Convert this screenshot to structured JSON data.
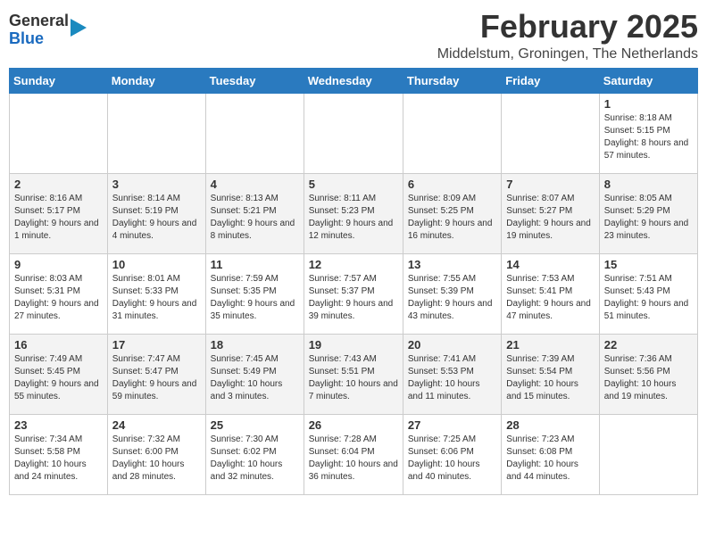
{
  "logo": {
    "general": "General",
    "blue": "Blue"
  },
  "title": "February 2025",
  "location": "Middelstum, Groningen, The Netherlands",
  "weekdays": [
    "Sunday",
    "Monday",
    "Tuesday",
    "Wednesday",
    "Thursday",
    "Friday",
    "Saturday"
  ],
  "weeks": [
    [
      {
        "day": "",
        "info": ""
      },
      {
        "day": "",
        "info": ""
      },
      {
        "day": "",
        "info": ""
      },
      {
        "day": "",
        "info": ""
      },
      {
        "day": "",
        "info": ""
      },
      {
        "day": "",
        "info": ""
      },
      {
        "day": "1",
        "info": "Sunrise: 8:18 AM\nSunset: 5:15 PM\nDaylight: 8 hours and 57 minutes."
      }
    ],
    [
      {
        "day": "2",
        "info": "Sunrise: 8:16 AM\nSunset: 5:17 PM\nDaylight: 9 hours and 1 minute."
      },
      {
        "day": "3",
        "info": "Sunrise: 8:14 AM\nSunset: 5:19 PM\nDaylight: 9 hours and 4 minutes."
      },
      {
        "day": "4",
        "info": "Sunrise: 8:13 AM\nSunset: 5:21 PM\nDaylight: 9 hours and 8 minutes."
      },
      {
        "day": "5",
        "info": "Sunrise: 8:11 AM\nSunset: 5:23 PM\nDaylight: 9 hours and 12 minutes."
      },
      {
        "day": "6",
        "info": "Sunrise: 8:09 AM\nSunset: 5:25 PM\nDaylight: 9 hours and 16 minutes."
      },
      {
        "day": "7",
        "info": "Sunrise: 8:07 AM\nSunset: 5:27 PM\nDaylight: 9 hours and 19 minutes."
      },
      {
        "day": "8",
        "info": "Sunrise: 8:05 AM\nSunset: 5:29 PM\nDaylight: 9 hours and 23 minutes."
      }
    ],
    [
      {
        "day": "9",
        "info": "Sunrise: 8:03 AM\nSunset: 5:31 PM\nDaylight: 9 hours and 27 minutes."
      },
      {
        "day": "10",
        "info": "Sunrise: 8:01 AM\nSunset: 5:33 PM\nDaylight: 9 hours and 31 minutes."
      },
      {
        "day": "11",
        "info": "Sunrise: 7:59 AM\nSunset: 5:35 PM\nDaylight: 9 hours and 35 minutes."
      },
      {
        "day": "12",
        "info": "Sunrise: 7:57 AM\nSunset: 5:37 PM\nDaylight: 9 hours and 39 minutes."
      },
      {
        "day": "13",
        "info": "Sunrise: 7:55 AM\nSunset: 5:39 PM\nDaylight: 9 hours and 43 minutes."
      },
      {
        "day": "14",
        "info": "Sunrise: 7:53 AM\nSunset: 5:41 PM\nDaylight: 9 hours and 47 minutes."
      },
      {
        "day": "15",
        "info": "Sunrise: 7:51 AM\nSunset: 5:43 PM\nDaylight: 9 hours and 51 minutes."
      }
    ],
    [
      {
        "day": "16",
        "info": "Sunrise: 7:49 AM\nSunset: 5:45 PM\nDaylight: 9 hours and 55 minutes."
      },
      {
        "day": "17",
        "info": "Sunrise: 7:47 AM\nSunset: 5:47 PM\nDaylight: 9 hours and 59 minutes."
      },
      {
        "day": "18",
        "info": "Sunrise: 7:45 AM\nSunset: 5:49 PM\nDaylight: 10 hours and 3 minutes."
      },
      {
        "day": "19",
        "info": "Sunrise: 7:43 AM\nSunset: 5:51 PM\nDaylight: 10 hours and 7 minutes."
      },
      {
        "day": "20",
        "info": "Sunrise: 7:41 AM\nSunset: 5:53 PM\nDaylight: 10 hours and 11 minutes."
      },
      {
        "day": "21",
        "info": "Sunrise: 7:39 AM\nSunset: 5:54 PM\nDaylight: 10 hours and 15 minutes."
      },
      {
        "day": "22",
        "info": "Sunrise: 7:36 AM\nSunset: 5:56 PM\nDaylight: 10 hours and 19 minutes."
      }
    ],
    [
      {
        "day": "23",
        "info": "Sunrise: 7:34 AM\nSunset: 5:58 PM\nDaylight: 10 hours and 24 minutes."
      },
      {
        "day": "24",
        "info": "Sunrise: 7:32 AM\nSunset: 6:00 PM\nDaylight: 10 hours and 28 minutes."
      },
      {
        "day": "25",
        "info": "Sunrise: 7:30 AM\nSunset: 6:02 PM\nDaylight: 10 hours and 32 minutes."
      },
      {
        "day": "26",
        "info": "Sunrise: 7:28 AM\nSunset: 6:04 PM\nDaylight: 10 hours and 36 minutes."
      },
      {
        "day": "27",
        "info": "Sunrise: 7:25 AM\nSunset: 6:06 PM\nDaylight: 10 hours and 40 minutes."
      },
      {
        "day": "28",
        "info": "Sunrise: 7:23 AM\nSunset: 6:08 PM\nDaylight: 10 hours and 44 minutes."
      },
      {
        "day": "",
        "info": ""
      }
    ]
  ]
}
